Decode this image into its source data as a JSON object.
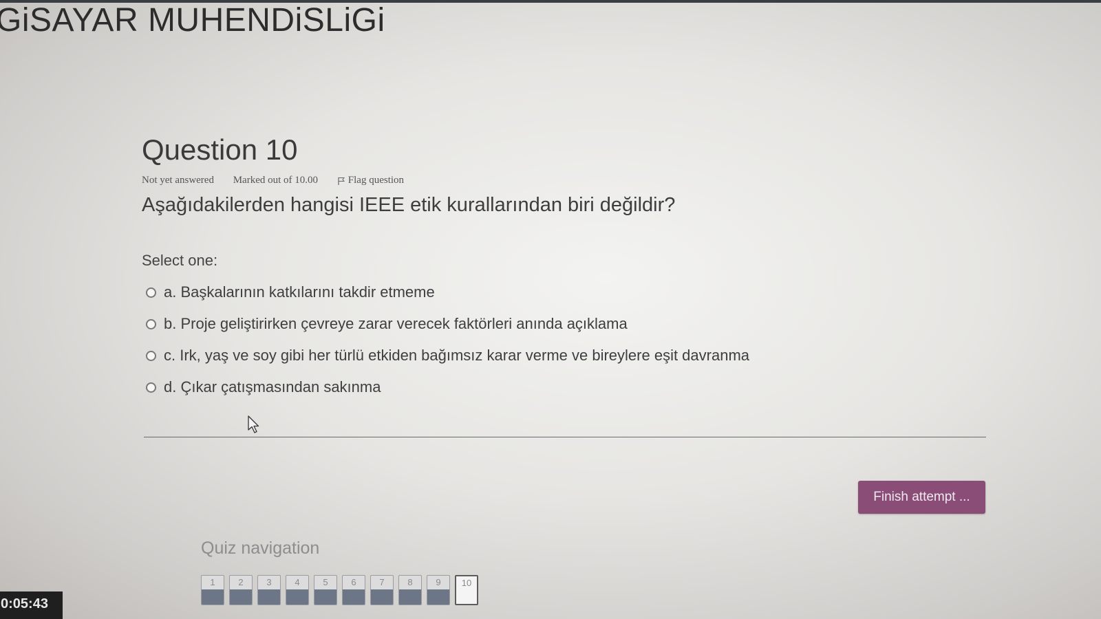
{
  "header": {
    "course_title": "GiSAYAR MUHENDiSLiGi"
  },
  "question": {
    "heading": "Question 10",
    "state": "Not yet answered",
    "grade": "Marked out of 10.00",
    "flag_label": "Flag question",
    "text": "Aşağıdakilerden hangisi IEEE etik kurallarından biri değildir?",
    "prompt": "Select one:",
    "answers": [
      {
        "label": "a. Başkalarının katkılarını takdir etmeme",
        "selected": false
      },
      {
        "label": "b. Proje geliştirirken çevreye zarar verecek faktörleri anında açıklama",
        "selected": false
      },
      {
        "label": "c. Irk, yaş ve soy gibi her türlü etkiden bağımsız karar verme ve bireylere eşit davranma",
        "selected": false
      },
      {
        "label": "d. Çıkar çatışmasından sakınma",
        "selected": false
      }
    ]
  },
  "actions": {
    "finish_label": "Finish attempt ..."
  },
  "quiz_navigation": {
    "title": "Quiz navigation",
    "buttons": [
      {
        "label": "1",
        "answered": true
      },
      {
        "label": "2",
        "answered": true
      },
      {
        "label": "3",
        "answered": true
      },
      {
        "label": "4",
        "answered": true
      },
      {
        "label": "5",
        "answered": true
      },
      {
        "label": "6",
        "answered": true
      },
      {
        "label": "7",
        "answered": true
      },
      {
        "label": "8",
        "answered": true
      },
      {
        "label": "9",
        "answered": true
      },
      {
        "label": "10",
        "answered": false,
        "current": true
      }
    ]
  },
  "timer": {
    "value": "0:05:43"
  },
  "colors": {
    "accent": "#8a4d78",
    "answered_fill": "#6c7687",
    "timer_bg": "#1f1f1f"
  }
}
